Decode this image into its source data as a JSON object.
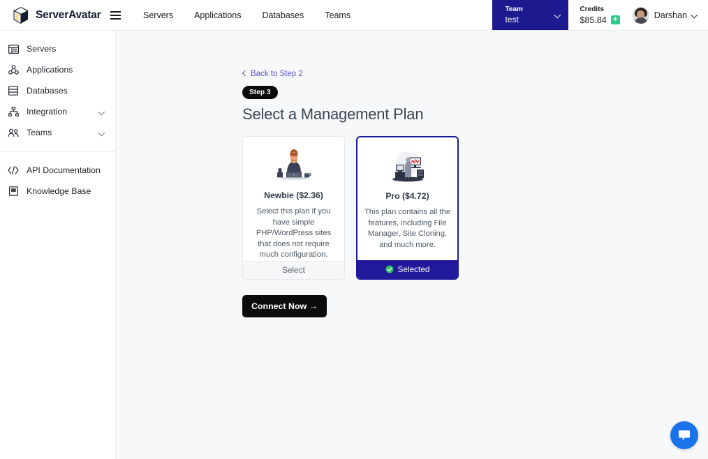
{
  "header": {
    "brand": "ServerAvatar",
    "menu_icon": "hamburger-icon",
    "nav": [
      {
        "label": "Servers"
      },
      {
        "label": "Applications"
      },
      {
        "label": "Databases"
      },
      {
        "label": "Teams"
      }
    ],
    "team": {
      "label": "Team",
      "value": "test",
      "bg_color": "#1c1a8e"
    },
    "credits": {
      "label": "Credits",
      "value": "$85.84",
      "add_label": "+",
      "add_color": "#2dca8c"
    },
    "user": {
      "name": "Darshan"
    }
  },
  "sidebar": {
    "items": [
      {
        "label": "Servers",
        "icon": "servers-icon",
        "expandable": false
      },
      {
        "label": "Applications",
        "icon": "applications-icon",
        "expandable": false
      },
      {
        "label": "Databases",
        "icon": "databases-icon",
        "expandable": false
      },
      {
        "label": "Integration",
        "icon": "integration-icon",
        "expandable": true
      },
      {
        "label": "Teams",
        "icon": "teams-icon",
        "expandable": true
      }
    ],
    "secondary_items": [
      {
        "label": "API Documentation",
        "icon": "code-icon"
      },
      {
        "label": "Knowledge Base",
        "icon": "book-icon"
      }
    ]
  },
  "main": {
    "back_link": "Back to Step 2",
    "step_badge": "Step 3",
    "title": "Select a Management Plan",
    "plans": [
      {
        "name": "Newbie ($2.36)",
        "description": "Select this plan if you have simple PHP/WordPress sites that does not require much configuration.",
        "action_label": "Select",
        "selected": false
      },
      {
        "name": "Pro ($4.72)",
        "description": "This plan contains all the features, including File Manager, Site Cloning, and much more.",
        "action_label": "Selected",
        "selected": true
      }
    ],
    "connect_button": "Connect Now →"
  },
  "chat": {
    "icon": "chat-bubble-icon",
    "color": "#1a73e8"
  }
}
